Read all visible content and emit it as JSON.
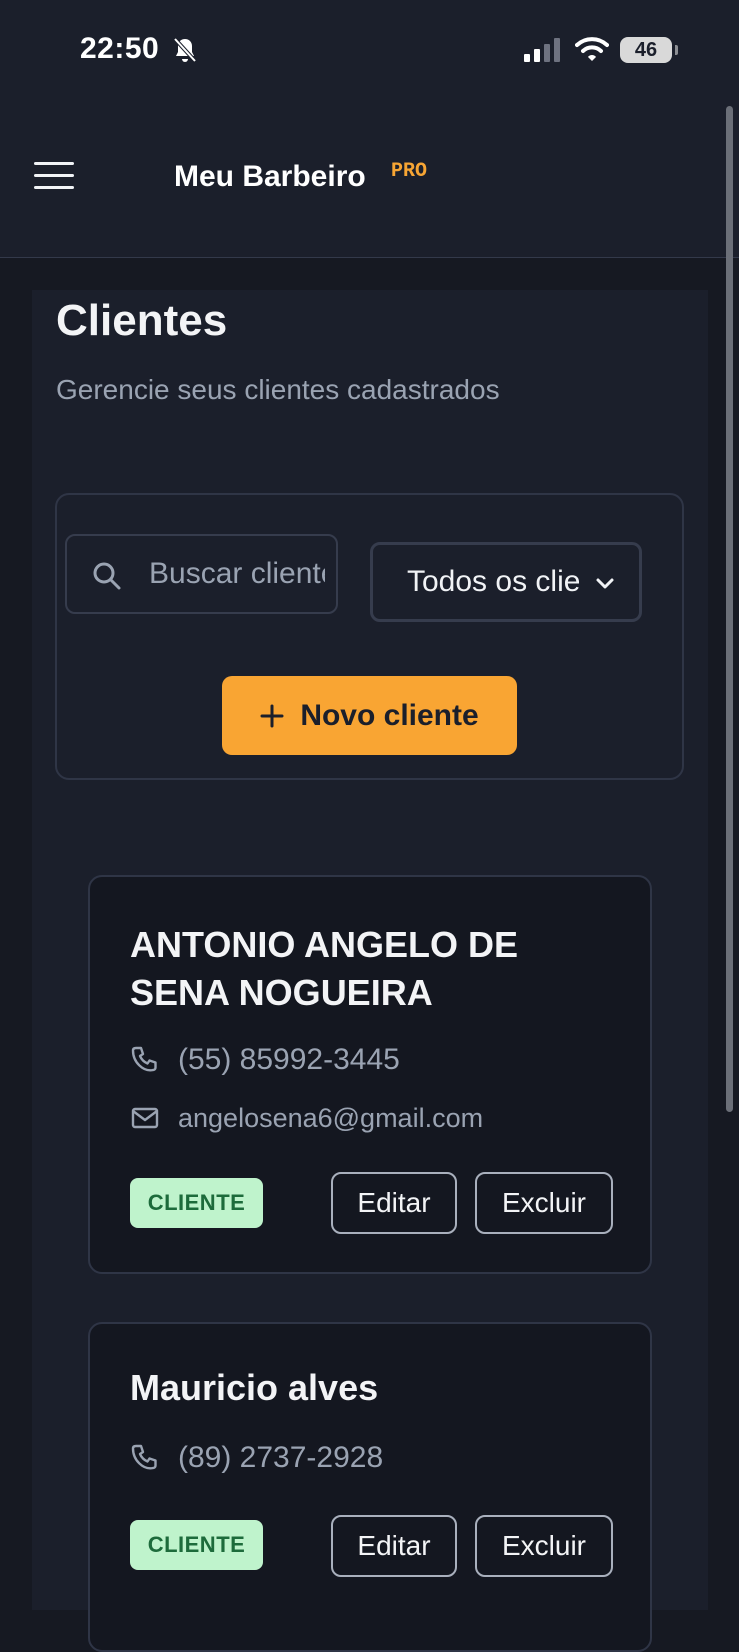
{
  "status_bar": {
    "time": "22:50",
    "battery": "46"
  },
  "header": {
    "brand": "Meu Barbeiro",
    "badge": "PRO"
  },
  "page": {
    "title": "Clientes",
    "subtitle": "Gerencie seus clientes cadastrados"
  },
  "filters": {
    "search_placeholder": "Buscar clientes",
    "search_value": "",
    "select_value": "Todos os clientes",
    "new_client_label": "Novo cliente"
  },
  "clients": [
    {
      "name": "ANTONIO ANGELO DE SENA NOGUEIRA",
      "phone": "(55) 85992-3445",
      "email": "angelosena6@gmail.com",
      "tag": "CLIENTE",
      "edit_label": "Editar",
      "delete_label": "Excluir"
    },
    {
      "name": "Mauricio alves",
      "phone": "(89) 2737-2928",
      "tag": "CLIENTE",
      "edit_label": "Editar",
      "delete_label": "Excluir"
    }
  ],
  "colors": {
    "accent": "#f9a533",
    "background": "#161922",
    "surface": "#1b1f2b",
    "tag_bg": "#bff3cc",
    "tag_text": "#1d6b3b"
  },
  "icons": [
    "bell-off-icon",
    "signal-icon",
    "wifi-icon",
    "battery-icon",
    "menu-icon",
    "search-icon",
    "chevron-down-icon",
    "plus-icon",
    "phone-icon",
    "mail-icon"
  ]
}
